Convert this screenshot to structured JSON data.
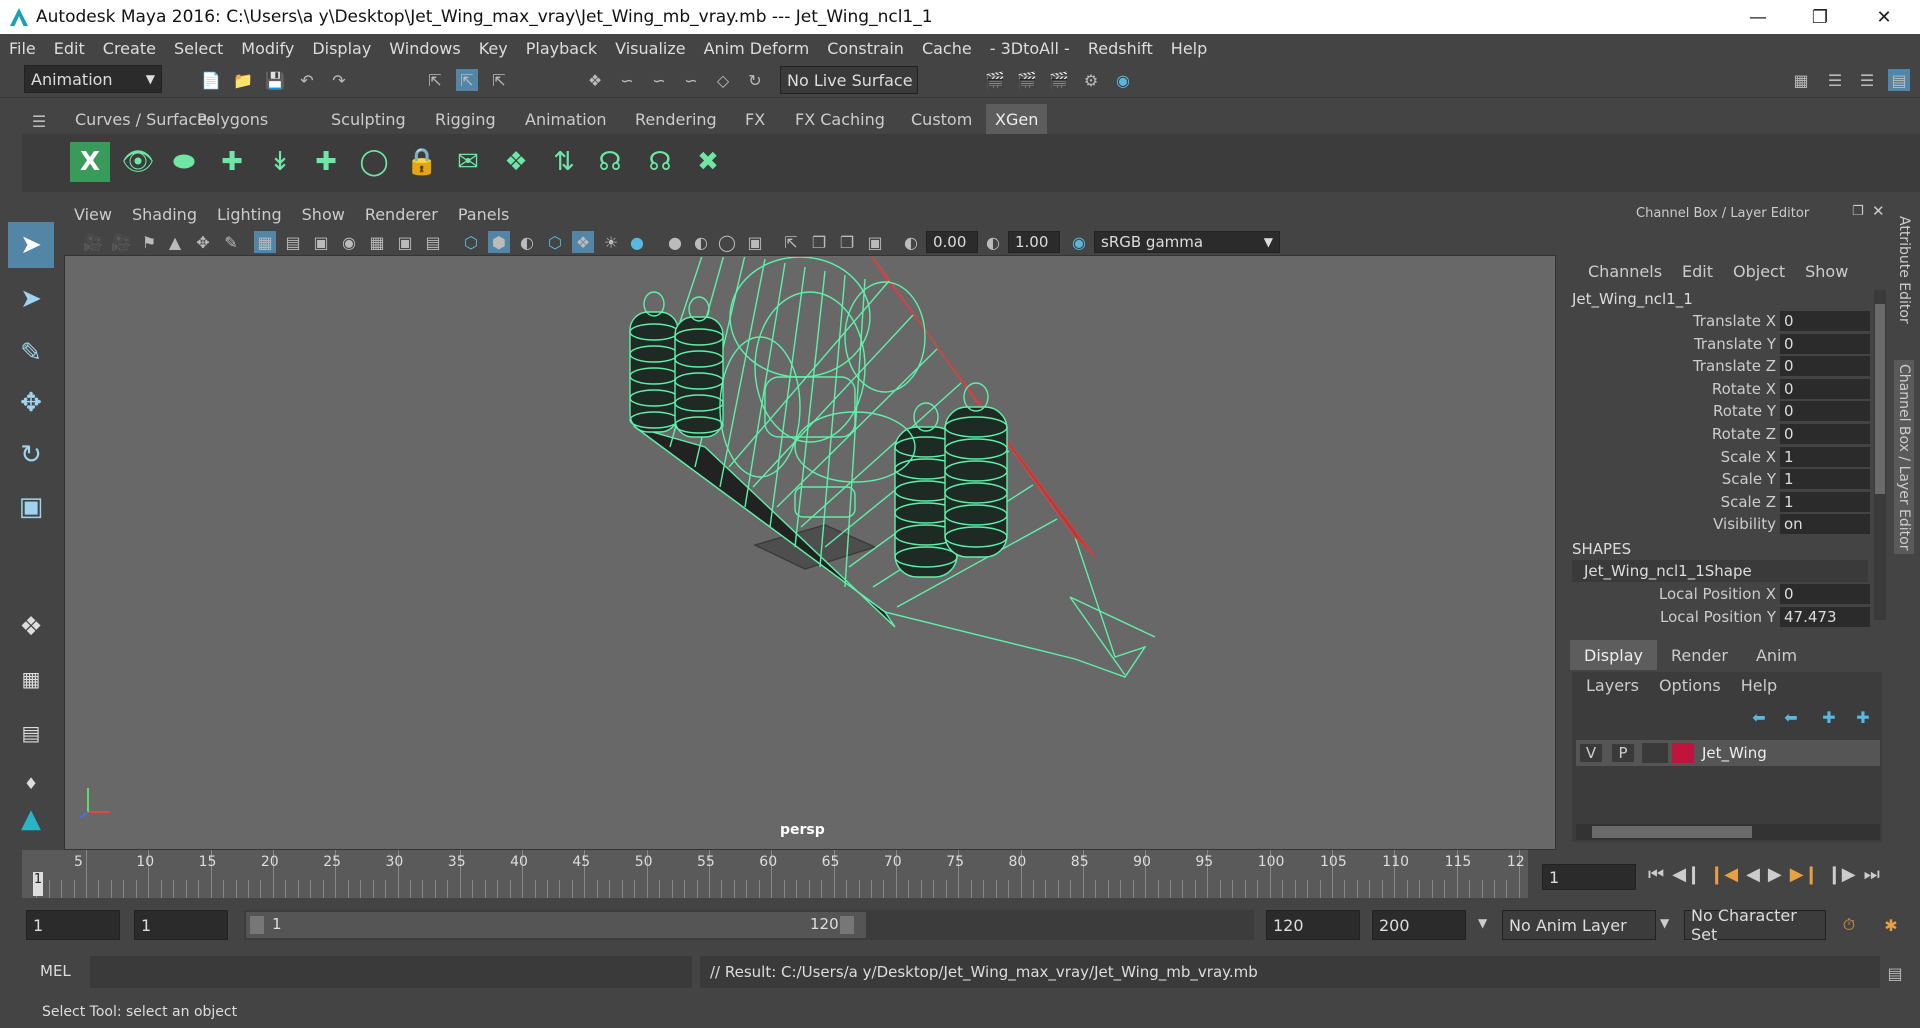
{
  "window": {
    "title": "Autodesk Maya 2016: C:\\Users\\a y\\Desktop\\Jet_Wing_max_vray\\Jet_Wing_mb_vray.mb   ---   Jet_Wing_ncl1_1"
  },
  "menubar": [
    "File",
    "Edit",
    "Create",
    "Select",
    "Modify",
    "Display",
    "Windows",
    "Key",
    "Playback",
    "Visualize",
    "Anim Deform",
    "Constrain",
    "Cache",
    "- 3DtoAll -",
    "Redshift",
    "Help"
  ],
  "statusline": {
    "menuset": "Animation",
    "live_surface": "No Live Surface"
  },
  "shelf": {
    "tabs": [
      "Curves / Surfaces",
      "Polygons",
      "Sculpting",
      "Rigging",
      "Animation",
      "Rendering",
      "FX",
      "FX Caching",
      "Custom",
      "XGen"
    ],
    "active": "XGen"
  },
  "viewport": {
    "menu": [
      "View",
      "Shading",
      "Lighting",
      "Show",
      "Renderer",
      "Panels"
    ],
    "exposure": "0.00",
    "gamma": "1.00",
    "colorspace": "sRGB gamma",
    "camera_label": "persp",
    "wire_color": "#5ff0a8"
  },
  "channelbox": {
    "title": "Channel Box / Layer Editor",
    "menu": [
      "Channels",
      "Edit",
      "Object",
      "Show"
    ],
    "object": "Jet_Wing_ncl1_1",
    "attributes": [
      {
        "name": "Translate X",
        "value": "0"
      },
      {
        "name": "Translate Y",
        "value": "0"
      },
      {
        "name": "Translate Z",
        "value": "0"
      },
      {
        "name": "Rotate X",
        "value": "0"
      },
      {
        "name": "Rotate Y",
        "value": "0"
      },
      {
        "name": "Rotate Z",
        "value": "0"
      },
      {
        "name": "Scale X",
        "value": "1"
      },
      {
        "name": "Scale Y",
        "value": "1"
      },
      {
        "name": "Scale Z",
        "value": "1"
      },
      {
        "name": "Visibility",
        "value": "on"
      }
    ],
    "shapes_header": "SHAPES",
    "shape_name": "Jet_Wing_ncl1_1Shape",
    "shape_attributes": [
      {
        "name": "Local Position X",
        "value": "0"
      },
      {
        "name": "Local Position Y",
        "value": "47.473"
      }
    ],
    "layer_tabs": [
      "Display",
      "Render",
      "Anim"
    ],
    "layer_menu": [
      "Layers",
      "Options",
      "Help"
    ],
    "layer": {
      "v": "V",
      "p": "P",
      "name": "Jet_Wing",
      "color": "#c0143c"
    },
    "side_tabs": [
      "Attribute Editor",
      "Channel Box / Layer Editor"
    ]
  },
  "timeline": {
    "ticks": [
      "5",
      "10",
      "15",
      "20",
      "25",
      "30",
      "35",
      "40",
      "45",
      "50",
      "55",
      "60",
      "65",
      "70",
      "75",
      "80",
      "85",
      "90",
      "95",
      "100",
      "105",
      "110",
      "115",
      "12"
    ],
    "current_frame_marker": "1",
    "current_frame": "1"
  },
  "range": {
    "start": "1",
    "playback_start": "1",
    "slider_start": "1",
    "slider_end": "120",
    "playback_end": "120",
    "end": "200",
    "anim_layer": "No Anim Layer",
    "character_set": "No Character Set"
  },
  "command": {
    "lang": "MEL",
    "result": "// Result: C:/Users/a y/Desktop/Jet_Wing_max_vray/Jet_Wing_mb_vray.mb"
  },
  "helpline": "Select Tool: select an object"
}
